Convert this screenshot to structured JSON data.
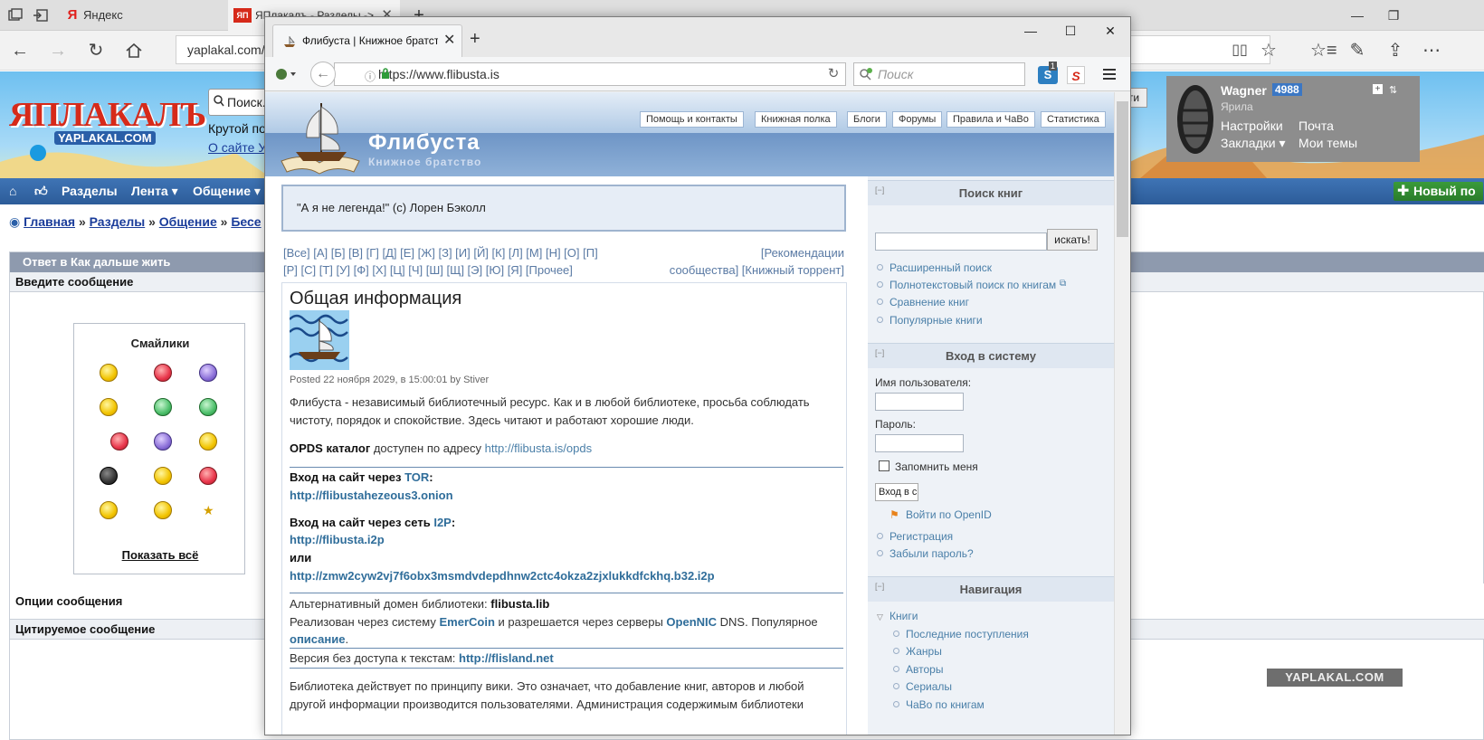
{
  "edge": {
    "tabs": [
      {
        "favicon": "Я",
        "label": "Яндекс"
      },
      {
        "favicon": "ЯП",
        "label": "ЯПлакалъ - Разделы ->"
      }
    ],
    "url": "yaplakal.com/act"
  },
  "yaplakal": {
    "logo": "ЯПЛАКАЛЪ",
    "logo_sub": "YAPLAKAL.COM",
    "search_placeholder": "Поиск...",
    "search_button": "ти",
    "tagline": "Крутой поис",
    "links": "О сайте  Уч",
    "menu": [
      "Разделы",
      "Лента ▾",
      "Общение ▾"
    ],
    "new_post": "Новый по",
    "breadcrumbs": [
      "Главная",
      "»",
      "Разделы",
      "»",
      "Общение",
      "»",
      "Бесе"
    ],
    "form_title": "Ответ в Как дальше жить",
    "sections": {
      "enter_message": "Введите сообщение",
      "options": "Опции сообщения",
      "quoted": "Цитируемое сообщение"
    },
    "smilies_title": "Смайлики",
    "show_all": "Показать всё",
    "user": {
      "name": "Wagner",
      "rep": "4988",
      "rank": "Ярила",
      "links": [
        "Настройки",
        "Почта",
        "Закладки ▾",
        "Мои темы"
      ]
    },
    "watermark": "YAPLAKAL.COM"
  },
  "firefox": {
    "tab_title": "Флибуста | Книжное братство",
    "url": "https://www.flibusta.is",
    "search_placeholder": "Поиск",
    "addon_badge": "1"
  },
  "flibusta": {
    "top_tabs": [
      "Помощь и контакты",
      "Книжная полка",
      "Блоги",
      "Форумы",
      "Правила и ЧаВо",
      "Статистика"
    ],
    "site_name": "Флибуста",
    "slogan": "Книжное братство",
    "quote": "\"А я не легенда!\" (c) Лорен Бэколл",
    "alphabet_line1": "[Все] [А] [Б] [В] [Г] [Д] [Е] [Ж] [З] [И] [Й] [К] [Л] [М] [Н] [О] [П]",
    "alphabet_line2": "[Р] [С] [Т] [У] [Ф] [Х] [Ц] [Ч] [Ш] [Щ] [Э] [Ю] [Я] [Прочее]",
    "recommend_line1": "[Рекомендации",
    "recommend_line2": "сообщества]  [Книжный торрент]",
    "main": {
      "title": "Общая информация",
      "posted": "Posted 22 ноября 2029, в 15:00:01 by Stiver",
      "intro": "Флибуста - независимый библиотечный ресурс. Как и в любой библиотеке, просьба соблюдать чистоту, порядок и спокойствие. Здесь читают и работают хорошие люди.",
      "opds_label": "OPDS каталог",
      "opds_text": " доступен по адресу ",
      "opds_url": "http://flibusta.is/opds",
      "tor_label": "Вход на сайт через ",
      "tor_name": "TOR",
      "tor_colon": ":",
      "tor_url": "http://flibustahezeous3.onion",
      "i2p_label": "Вход на сайт через сеть ",
      "i2p_name": "I2P",
      "i2p_colon": ":",
      "i2p_url": "http://flibusta.i2p",
      "or": "или",
      "i2p_url2": "http://zmw2cyw2vj7f6obx3msmdvdepdhnw2ctc4okza2zjxlukkdfckhq.b32.i2p",
      "alt_domain_label": "Альтернативный домен библиотеки: ",
      "alt_domain": "flibusta.lib",
      "emercoin_pre": "Реализован через систему ",
      "emercoin": "EmerCoin",
      "emercoin_mid": " и разрешается через серверы ",
      "opennic": "OpenNIC",
      "emercoin_post": " DNS. Популярное",
      "description": "описание",
      "dot": ".",
      "noaccess_label": "Версия без доступа к текстам: ",
      "noaccess_url": "http://flisland.net",
      "wiki": "Библиотека действует по принципу вики. Это означает, что добавление книг, авторов и любой",
      "wiki2": "другой информации производится пользователями. Администрация содержимым библиотеки"
    },
    "sidebar": {
      "search_title": "Поиск книг",
      "search_button": "искать!",
      "search_links": [
        "Расширенный поиск",
        "Полнотекстовый поиск по книгам",
        "Сравнение книг",
        "Популярные книги"
      ],
      "login_title": "Вход в систему",
      "username_label": "Имя пользователя:",
      "password_label": "Пароль:",
      "remember": "Запомнить меня",
      "login_button": "Вход в с",
      "openid": "Войти по OpenID",
      "login_links": [
        "Регистрация",
        "Забыли пароль?"
      ],
      "nav_title": "Навигация",
      "nav_root": "Книги",
      "nav_items": [
        "Последние поступления",
        "Жанры",
        "Авторы",
        "Сериалы",
        "ЧаВо по книгам"
      ],
      "collapse": "[−]"
    }
  }
}
